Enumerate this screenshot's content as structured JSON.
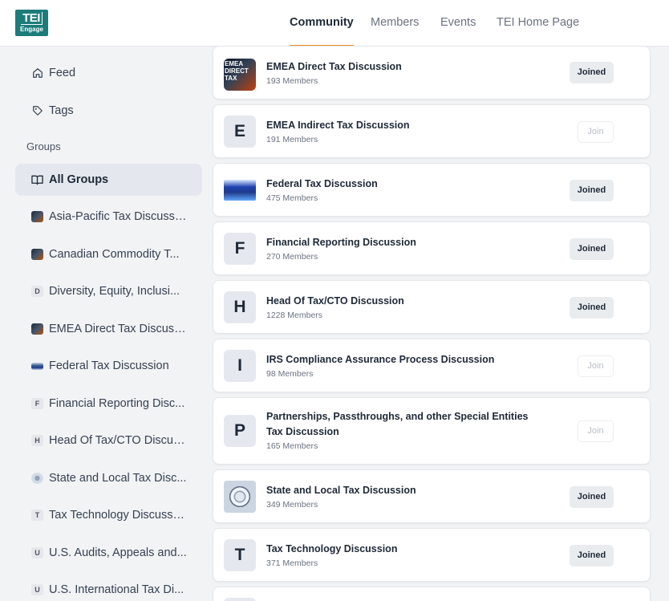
{
  "brand": {
    "logo_top": "TEI",
    "logo_bottom": "Engage"
  },
  "nav": {
    "items": [
      {
        "label": "Community",
        "active": true
      },
      {
        "label": "Members"
      },
      {
        "label": "Events"
      },
      {
        "label": "TEI Home Page"
      }
    ]
  },
  "sidebar": {
    "feed": "Feed",
    "tags": "Tags",
    "groups_heading": "Groups",
    "items": [
      {
        "label": "All Groups",
        "icon": "book-open-icon",
        "active": true
      },
      {
        "label": "Asia-Pacific Tax Discussion",
        "icon": "image"
      },
      {
        "label": "Canadian Commodity T...",
        "icon": "image"
      },
      {
        "label": "Diversity, Equity, Inclusi...",
        "icon": "letter",
        "letter": "D"
      },
      {
        "label": "EMEA Direct Tax Discuss...",
        "icon": "image"
      },
      {
        "label": "Federal Tax Discussion",
        "icon": "image"
      },
      {
        "label": "Financial Reporting Disc...",
        "icon": "letter",
        "letter": "F"
      },
      {
        "label": "Head Of Tax/CTO Discus...",
        "icon": "letter",
        "letter": "H"
      },
      {
        "label": "State and Local Tax Disc...",
        "icon": "image"
      },
      {
        "label": "Tax Technology Discussion",
        "icon": "letter",
        "letter": "T"
      },
      {
        "label": "U.S. Audits, Appeals and...",
        "icon": "letter",
        "letter": "U"
      },
      {
        "label": "U.S. International Tax Di...",
        "icon": "letter",
        "letter": "U"
      }
    ]
  },
  "groups": [
    {
      "name": "EMEA Direct Tax Discussion",
      "members": "193 Members",
      "avatar_text": "EMEA DIRECT TAX",
      "status": "Joined"
    },
    {
      "name": "EMEA Indirect Tax Discussion",
      "members": "191 Members",
      "avatar_letter": "E",
      "status": "Join"
    },
    {
      "name": "Federal Tax Discussion",
      "members": "475 Members",
      "status": "Joined"
    },
    {
      "name": "Financial Reporting Discussion",
      "members": "270 Members",
      "avatar_letter": "F",
      "status": "Joined"
    },
    {
      "name": "Head Of Tax/CTO Discussion",
      "members": "1228 Members",
      "avatar_letter": "H",
      "status": "Joined"
    },
    {
      "name": "IRS Compliance Assurance Process Discussion",
      "members": "98 Members",
      "avatar_letter": "I",
      "status": "Join"
    },
    {
      "name": "Partnerships, Passthroughs, and other Special Entities Tax Discussion",
      "members": "165 Members",
      "avatar_letter": "P",
      "status": "Join"
    },
    {
      "name": "State and Local Tax Discussion",
      "members": "349 Members",
      "status": "Joined"
    },
    {
      "name": "Tax Technology Discussion",
      "members": "371 Members",
      "avatar_letter": "T",
      "status": "Joined"
    }
  ]
}
